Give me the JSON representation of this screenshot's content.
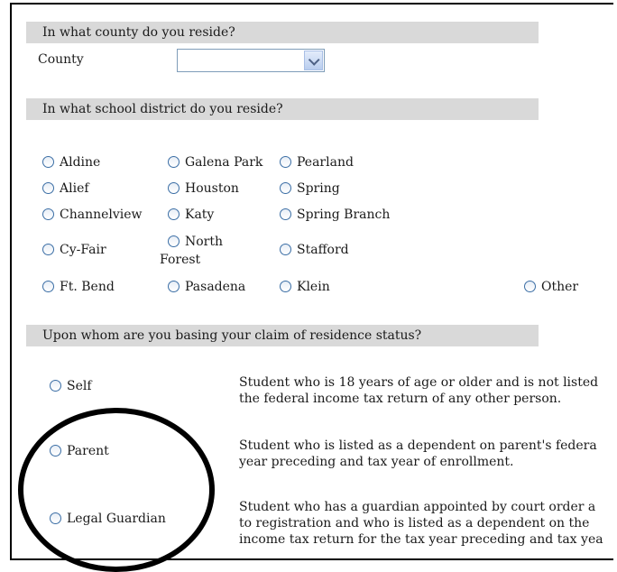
{
  "county_section": {
    "question": "In what county do you reside?",
    "label": "County",
    "selected_value": ""
  },
  "district_section": {
    "question": "In what school district do you reside?",
    "districts": [
      "Aldine",
      "Galena Park",
      "Pearland",
      "Alief",
      "Houston",
      "Spring",
      "Channelview",
      "Katy",
      "Spring Branch",
      "Cy-Fair",
      "North Forest",
      "Stafford",
      "Ft. Bend",
      "Pasadena",
      "Klein",
      "Other"
    ]
  },
  "residence_section": {
    "question": "Upon whom are you basing your claim of residence status?",
    "options": [
      {
        "label": "Self",
        "desc": [
          "Student who is 18 years of age or older and is not listed",
          "the federal income tax return of any other person."
        ]
      },
      {
        "label": "Parent",
        "desc": [
          "Student who is listed as a dependent on parent's federa",
          "year preceding and tax year of enrollment."
        ]
      },
      {
        "label": "Legal Guardian",
        "desc": [
          "Student who has a guardian appointed by court order a",
          "to registration and who is listed as a dependent on the",
          "income tax return for the tax year preceding and tax yea"
        ]
      }
    ]
  }
}
